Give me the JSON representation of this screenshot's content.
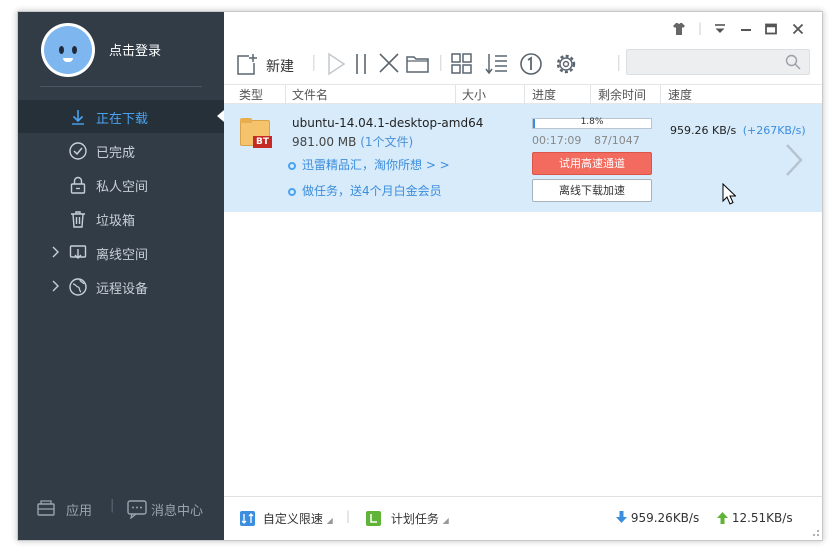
{
  "sidebar": {
    "login_label": "点击登录",
    "items": [
      {
        "label": "正在下载",
        "icon": "download-arrow-icon",
        "active": true
      },
      {
        "label": "已完成",
        "icon": "check-circle-icon"
      },
      {
        "label": "私人空间",
        "icon": "lock-icon"
      },
      {
        "label": "垃圾箱",
        "icon": "trash-icon"
      },
      {
        "label": "离线空间",
        "icon": "offline-download-icon",
        "expandable": true
      },
      {
        "label": "远程设备",
        "icon": "globe-device-icon",
        "expandable": true
      }
    ],
    "apps_label": "应用",
    "messages_label": "消息中心"
  },
  "toolbar": {
    "new_label": "新建",
    "icons": [
      "start-icon",
      "pause-icon",
      "delete-icon",
      "folder-icon",
      "grid-view-icon",
      "sort-icon",
      "single-task-icon",
      "settings-gear-icon"
    ],
    "search_placeholder": ""
  },
  "window_controls": [
    "skin-icon",
    "menu-dropdown-icon",
    "minimize-icon",
    "maximize-icon",
    "close-icon"
  ],
  "columns": [
    "类型",
    "文件名",
    "大小",
    "进度",
    "剩余时间",
    "速度"
  ],
  "task": {
    "name": "ubuntu-14.04.1-desktop-amd64",
    "size": "981.00 MB",
    "file_count": "(1个文件)",
    "progress_label": "1.8%",
    "progress": 0.018,
    "elapsed": "00:17:09",
    "pieces": "87/1047",
    "speed": "959.26 KB/s",
    "boost": "(+267KB/s)",
    "type_badge": "BT",
    "fast_channel_button": "试用高速通道",
    "offline_button": "离线下载加速",
    "promo1": "迅雷精品汇，淘你所想 > >",
    "promo2": "做任务，送4个月白金会员"
  },
  "statusbar": {
    "speed_limit_label": "自定义限速",
    "schedule_label": "计划任务",
    "down_speed": "959.26KB/s",
    "up_speed": "12.51KB/s"
  },
  "colors": {
    "sidebar": "#323c47",
    "accent": "#4aa3f0",
    "row_selected": "#d7ebfa",
    "red_button": "#f36b5e",
    "green": "#5fb336"
  }
}
